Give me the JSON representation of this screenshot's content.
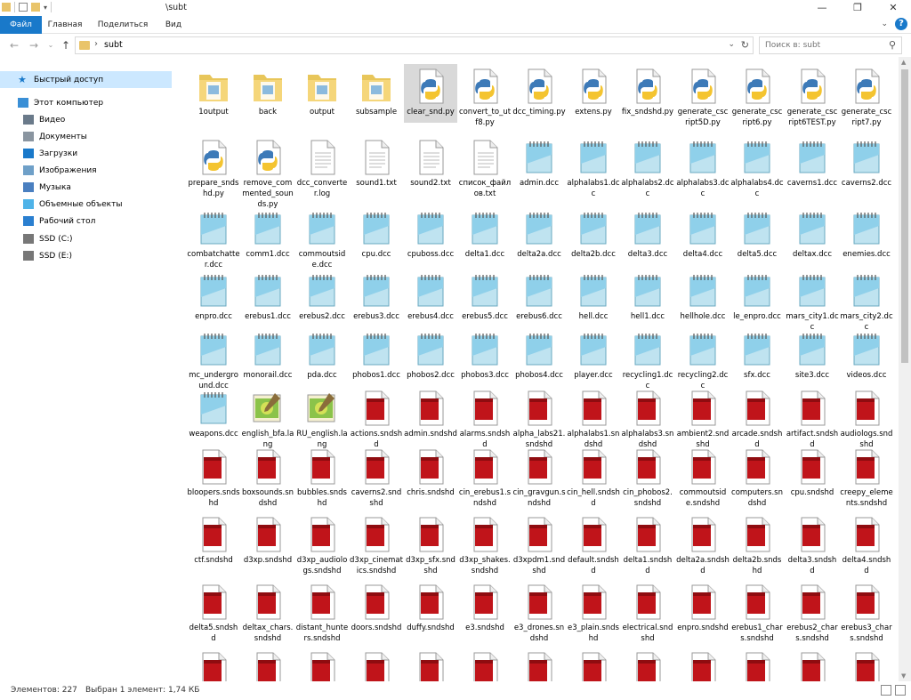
{
  "window": {
    "title": "\\subt"
  },
  "ribbon": {
    "tabs": [
      "Файл",
      "Главная",
      "Поделиться",
      "Вид"
    ]
  },
  "address": {
    "path": "subt",
    "search_placeholder": "Поиск в: subt"
  },
  "sidebar": {
    "items": [
      {
        "label": "Быстрый доступ",
        "icon": "star-icon",
        "selected": true
      },
      {
        "label": "Этот компьютер",
        "icon": "computer-icon"
      },
      {
        "label": "Видео",
        "icon": "video-icon"
      },
      {
        "label": "Документы",
        "icon": "document-icon"
      },
      {
        "label": "Загрузки",
        "icon": "download-icon"
      },
      {
        "label": "Изображения",
        "icon": "image-icon"
      },
      {
        "label": "Музыка",
        "icon": "music-icon"
      },
      {
        "label": "Объемные объекты",
        "icon": "3d-objects-icon"
      },
      {
        "label": "Рабочий стол",
        "icon": "desktop-icon"
      },
      {
        "label": "SSD (C:)",
        "icon": "drive-icon"
      },
      {
        "label": "SSD (E:)",
        "icon": "drive-icon"
      }
    ]
  },
  "files": [
    {
      "label": "1output",
      "kind": "folder"
    },
    {
      "label": "back",
      "kind": "folder"
    },
    {
      "label": "output",
      "kind": "folder"
    },
    {
      "label": "subsample",
      "kind": "folder"
    },
    {
      "label": "clear_snd.py",
      "kind": "py",
      "selected": true
    },
    {
      "label": "convert_to_utf8.py",
      "kind": "py"
    },
    {
      "label": "dcc_timing.py",
      "kind": "py"
    },
    {
      "label": "extens.py",
      "kind": "py"
    },
    {
      "label": "fix_sndshd.py",
      "kind": "py"
    },
    {
      "label": "generate_cscript5D.py",
      "kind": "py"
    },
    {
      "label": "generate_cscript6.py",
      "kind": "py"
    },
    {
      "label": "generate_cscript6TEST.py",
      "kind": "py"
    },
    {
      "label": "generate_cscript7.py",
      "kind": "py"
    },
    {
      "label": "prepare_sndshd.py",
      "kind": "py"
    },
    {
      "label": "remove_commented_sounds.py",
      "kind": "py"
    },
    {
      "label": "dcc_converter.log",
      "kind": "txt"
    },
    {
      "label": "sound1.txt",
      "kind": "txt"
    },
    {
      "label": "sound2.txt",
      "kind": "txt"
    },
    {
      "label": "список_файлов.txt",
      "kind": "txt"
    },
    {
      "label": "admin.dcc",
      "kind": "dcc"
    },
    {
      "label": "alphalabs1.dcc",
      "kind": "dcc"
    },
    {
      "label": "alphalabs2.dcc",
      "kind": "dcc"
    },
    {
      "label": "alphalabs3.dcc",
      "kind": "dcc"
    },
    {
      "label": "alphalabs4.dcc",
      "kind": "dcc"
    },
    {
      "label": "caverns1.dcc",
      "kind": "dcc"
    },
    {
      "label": "caverns2.dcc",
      "kind": "dcc"
    },
    {
      "label": "combatchatter.dcc",
      "kind": "dcc"
    },
    {
      "label": "comm1.dcc",
      "kind": "dcc"
    },
    {
      "label": "commoutside.dcc",
      "kind": "dcc"
    },
    {
      "label": "cpu.dcc",
      "kind": "dcc"
    },
    {
      "label": "cpuboss.dcc",
      "kind": "dcc"
    },
    {
      "label": "delta1.dcc",
      "kind": "dcc"
    },
    {
      "label": "delta2a.dcc",
      "kind": "dcc"
    },
    {
      "label": "delta2b.dcc",
      "kind": "dcc"
    },
    {
      "label": "delta3.dcc",
      "kind": "dcc"
    },
    {
      "label": "delta4.dcc",
      "kind": "dcc"
    },
    {
      "label": "delta5.dcc",
      "kind": "dcc"
    },
    {
      "label": "deltax.dcc",
      "kind": "dcc"
    },
    {
      "label": "enemies.dcc",
      "kind": "dcc"
    },
    {
      "label": "enpro.dcc",
      "kind": "dcc"
    },
    {
      "label": "erebus1.dcc",
      "kind": "dcc"
    },
    {
      "label": "erebus2.dcc",
      "kind": "dcc"
    },
    {
      "label": "erebus3.dcc",
      "kind": "dcc"
    },
    {
      "label": "erebus4.dcc",
      "kind": "dcc"
    },
    {
      "label": "erebus5.dcc",
      "kind": "dcc"
    },
    {
      "label": "erebus6.dcc",
      "kind": "dcc"
    },
    {
      "label": "hell.dcc",
      "kind": "dcc"
    },
    {
      "label": "hell1.dcc",
      "kind": "dcc"
    },
    {
      "label": "hellhole.dcc",
      "kind": "dcc"
    },
    {
      "label": "le_enpro.dcc",
      "kind": "dcc"
    },
    {
      "label": "mars_city1.dcc",
      "kind": "dcc"
    },
    {
      "label": "mars_city2.dcc",
      "kind": "dcc"
    },
    {
      "label": "mc_underground.dcc",
      "kind": "dcc"
    },
    {
      "label": "monorail.dcc",
      "kind": "dcc"
    },
    {
      "label": "pda.dcc",
      "kind": "dcc"
    },
    {
      "label": "phobos1.dcc",
      "kind": "dcc"
    },
    {
      "label": "phobos2.dcc",
      "kind": "dcc"
    },
    {
      "label": "phobos3.dcc",
      "kind": "dcc"
    },
    {
      "label": "phobos4.dcc",
      "kind": "dcc"
    },
    {
      "label": "player.dcc",
      "kind": "dcc"
    },
    {
      "label": "recycling1.dcc",
      "kind": "dcc"
    },
    {
      "label": "recycling2.dcc",
      "kind": "dcc"
    },
    {
      "label": "sfx.dcc",
      "kind": "dcc"
    },
    {
      "label": "site3.dcc",
      "kind": "dcc"
    },
    {
      "label": "videos.dcc",
      "kind": "dcc"
    },
    {
      "label": "weapons.dcc",
      "kind": "dcc"
    },
    {
      "label": "english_bfa.lang",
      "kind": "lang"
    },
    {
      "label": "RU_english.lang",
      "kind": "lang"
    },
    {
      "label": "actions.sndshd",
      "kind": "sndshd"
    },
    {
      "label": "admin.sndshd",
      "kind": "sndshd"
    },
    {
      "label": "alarms.sndshd",
      "kind": "sndshd"
    },
    {
      "label": "alpha_labs21.sndshd",
      "kind": "sndshd"
    },
    {
      "label": "alphalabs1.sndshd",
      "kind": "sndshd"
    },
    {
      "label": "alphalabs3.sndshd",
      "kind": "sndshd"
    },
    {
      "label": "ambient2.sndshd",
      "kind": "sndshd"
    },
    {
      "label": "arcade.sndshd",
      "kind": "sndshd"
    },
    {
      "label": "artifact.sndshd",
      "kind": "sndshd"
    },
    {
      "label": "audiologs.sndshd",
      "kind": "sndshd"
    },
    {
      "label": "bloopers.sndshd",
      "kind": "sndshd"
    },
    {
      "label": "boxsounds.sndshd",
      "kind": "sndshd"
    },
    {
      "label": "bubbles.sndshd",
      "kind": "sndshd"
    },
    {
      "label": "caverns2.sndshd",
      "kind": "sndshd"
    },
    {
      "label": "chris.sndshd",
      "kind": "sndshd"
    },
    {
      "label": "cin_erebus1.sndshd",
      "kind": "sndshd"
    },
    {
      "label": "cin_gravgun.sndshd",
      "kind": "sndshd"
    },
    {
      "label": "cin_hell.sndshd",
      "kind": "sndshd"
    },
    {
      "label": "cin_phobos2.sndshd",
      "kind": "sndshd"
    },
    {
      "label": "commoutside.sndshd",
      "kind": "sndshd"
    },
    {
      "label": "computers.sndshd",
      "kind": "sndshd"
    },
    {
      "label": "cpu.sndshd",
      "kind": "sndshd"
    },
    {
      "label": "creepy_elements.sndshd",
      "kind": "sndshd"
    },
    {
      "label": "ctf.sndshd",
      "kind": "sndshd"
    },
    {
      "label": "d3xp.sndshd",
      "kind": "sndshd"
    },
    {
      "label": "d3xp_audiologs.sndshd",
      "kind": "sndshd"
    },
    {
      "label": "d3xp_cinematics.sndshd",
      "kind": "sndshd"
    },
    {
      "label": "d3xp_sfx.sndshd",
      "kind": "sndshd"
    },
    {
      "label": "d3xp_shakes.sndshd",
      "kind": "sndshd"
    },
    {
      "label": "d3xpdm1.sndshd",
      "kind": "sndshd"
    },
    {
      "label": "default.sndshd",
      "kind": "sndshd"
    },
    {
      "label": "delta1.sndshd",
      "kind": "sndshd"
    },
    {
      "label": "delta2a.sndshd",
      "kind": "sndshd"
    },
    {
      "label": "delta2b.sndshd",
      "kind": "sndshd"
    },
    {
      "label": "delta3.sndshd",
      "kind": "sndshd"
    },
    {
      "label": "delta4.sndshd",
      "kind": "sndshd"
    },
    {
      "label": "delta5.sndshd",
      "kind": "sndshd"
    },
    {
      "label": "deltax_chars.sndshd",
      "kind": "sndshd"
    },
    {
      "label": "distant_hunters.sndshd",
      "kind": "sndshd"
    },
    {
      "label": "doors.sndshd",
      "kind": "sndshd"
    },
    {
      "label": "duffy.sndshd",
      "kind": "sndshd"
    },
    {
      "label": "e3.sndshd",
      "kind": "sndshd"
    },
    {
      "label": "e3_drones.sndshd",
      "kind": "sndshd"
    },
    {
      "label": "e3_plain.sndshd",
      "kind": "sndshd"
    },
    {
      "label": "electrical.sndshd",
      "kind": "sndshd"
    },
    {
      "label": "enpro.sndshd",
      "kind": "sndshd"
    },
    {
      "label": "erebus1_chars.sndshd",
      "kind": "sndshd"
    },
    {
      "label": "erebus2_chars.sndshd",
      "kind": "sndshd"
    },
    {
      "label": "erebus3_chars.sndshd",
      "kind": "sndshd"
    },
    {
      "label": "",
      "kind": "sndshd"
    },
    {
      "label": "",
      "kind": "sndshd"
    },
    {
      "label": "",
      "kind": "sndshd"
    },
    {
      "label": "",
      "kind": "sndshd"
    },
    {
      "label": "",
      "kind": "sndshd"
    },
    {
      "label": "",
      "kind": "sndshd"
    },
    {
      "label": "",
      "kind": "sndshd"
    },
    {
      "label": "",
      "kind": "sndshd"
    },
    {
      "label": "",
      "kind": "sndshd"
    },
    {
      "label": "",
      "kind": "sndshd"
    },
    {
      "label": "",
      "kind": "sndshd"
    },
    {
      "label": "",
      "kind": "sndshd"
    },
    {
      "label": "",
      "kind": "sndshd"
    }
  ],
  "status": {
    "count": "Элементов: 227",
    "selection": "Выбран 1 элемент: 1,74 КБ"
  },
  "colors": {
    "accent": "#1979ca",
    "selection": "#d9d9d9",
    "nav_selected": "#cce8ff"
  }
}
